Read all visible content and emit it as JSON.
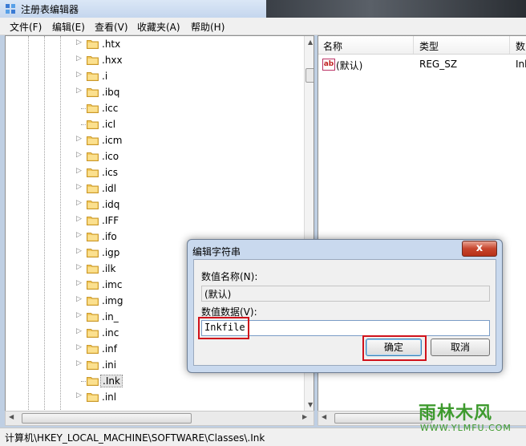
{
  "window": {
    "title": "注册表编辑器"
  },
  "menu": [
    "文件(F)",
    "编辑(E)",
    "查看(V)",
    "收藏夹(A)",
    "帮助(H)"
  ],
  "tree": {
    "items": [
      ".htx",
      ".hxx",
      ".i",
      ".ibq",
      ".icc",
      ".icl",
      ".icm",
      ".ico",
      ".ics",
      ".idl",
      ".idq",
      ".IFF",
      ".ifo",
      ".igp",
      ".ilk",
      ".imc",
      ".img",
      ".in_",
      ".inc",
      ".inf",
      ".ini",
      ".Ink",
      ".inl"
    ],
    "expandable": [
      true,
      true,
      true,
      true,
      false,
      false,
      true,
      true,
      true,
      true,
      true,
      true,
      true,
      true,
      true,
      true,
      true,
      true,
      true,
      true,
      true,
      false,
      true
    ],
    "selected": ".Ink"
  },
  "list": {
    "headers": {
      "name": "名称",
      "type": "类型",
      "data": "数"
    },
    "rows": [
      {
        "name": "(默认)",
        "type": "REG_SZ",
        "data": "Ink"
      }
    ]
  },
  "status": {
    "path": "计算机\\HKEY_LOCAL_MACHINE\\SOFTWARE\\Classes\\.Ink"
  },
  "dialog": {
    "title": "编辑字符串",
    "close": "x",
    "value_name_label": "数值名称(N):",
    "value_name": "(默认)",
    "value_data_label": "数值数据(V):",
    "value_data": "Inkfile",
    "ok": "确定",
    "cancel": "取消"
  },
  "watermark": {
    "title": "雨林木风",
    "url": "WWW.YLMFU.COM"
  },
  "colors": {
    "highlight": "#d0121b",
    "watermark": "#3e9a2e",
    "dialog_frame": "#c9d9ee"
  }
}
